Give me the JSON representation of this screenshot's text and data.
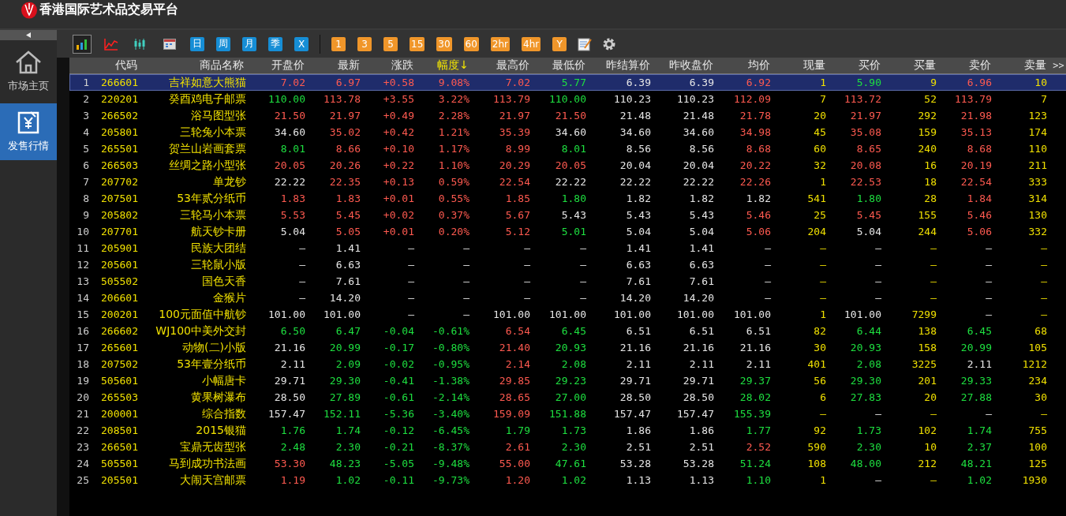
{
  "window": {
    "title": "香港国际艺术品交易平台"
  },
  "sidebar": {
    "items": [
      {
        "label": "市场主页",
        "selected": false
      },
      {
        "label": "发售行情",
        "selected": true
      }
    ]
  },
  "toolbar": {
    "chart_types": [
      {
        "selected": true
      },
      {
        "selected": false
      },
      {
        "selected": false
      },
      {
        "selected": false
      }
    ],
    "periods": [
      {
        "label": "日",
        "kind": "span"
      },
      {
        "label": "周",
        "kind": "span"
      },
      {
        "label": "月",
        "kind": "span"
      },
      {
        "label": "季",
        "kind": "span"
      },
      {
        "label": "X",
        "kind": "span"
      },
      {
        "label": "1",
        "kind": "interval"
      },
      {
        "label": "3",
        "kind": "interval"
      },
      {
        "label": "5",
        "kind": "interval"
      },
      {
        "label": "15",
        "kind": "interval"
      },
      {
        "label": "30",
        "kind": "interval"
      },
      {
        "label": "60",
        "kind": "interval"
      },
      {
        "label": "2hr",
        "kind": "interval"
      },
      {
        "label": "4hr",
        "kind": "interval"
      },
      {
        "label": "Y",
        "kind": "interval"
      }
    ]
  },
  "table": {
    "code_header": "代码",
    "name_header": "商品名称",
    "columns": [
      {
        "label": "开盘价",
        "sorted": false
      },
      {
        "label": "最新",
        "sorted": false
      },
      {
        "label": "涨跌",
        "sorted": false
      },
      {
        "label": "幅度↓",
        "sorted": true
      },
      {
        "label": "最高价",
        "sorted": false
      },
      {
        "label": "最低价",
        "sorted": false
      },
      {
        "label": "昨结算价",
        "sorted": false
      },
      {
        "label": "昨收盘价",
        "sorted": false
      },
      {
        "label": "均价",
        "sorted": false
      },
      {
        "label": "现量",
        "sorted": false,
        "kind": "quantity"
      },
      {
        "label": "买价",
        "sorted": false
      },
      {
        "label": "买量",
        "sorted": false,
        "kind": "quantity"
      },
      {
        "label": "卖价",
        "sorted": false
      },
      {
        "label": "卖量",
        "sorted": false,
        "kind": "quantity"
      }
    ],
    "more_columns": ">>",
    "rows": [
      {
        "index": "1",
        "code": "266601",
        "name": "吉祥如意大熊猫",
        "selected": true,
        "cells": [
          {
            "text": "7.02",
            "color": "#ff5a50"
          },
          {
            "text": "6.97",
            "color": "#ff5a50"
          },
          {
            "text": "+0.58",
            "color": "#ff5a50"
          },
          {
            "text": "9.08%",
            "color": "#ff5a50"
          },
          {
            "text": "7.02",
            "color": "#ff5a50"
          },
          {
            "text": "5.77",
            "color": "#1ee040"
          },
          {
            "text": "6.39",
            "color": "#e6e6e6"
          },
          {
            "text": "6.39",
            "color": "#e6e6e6"
          },
          {
            "text": "6.92",
            "color": "#ff5a50"
          },
          {
            "text": "1",
            "color": "#f0e000"
          },
          {
            "text": "5.90",
            "color": "#1ee040"
          },
          {
            "text": "9",
            "color": "#f0e000"
          },
          {
            "text": "6.96",
            "color": "#ff5a50"
          },
          {
            "text": "10",
            "color": "#f0e000"
          }
        ]
      },
      {
        "index": "2",
        "code": "220201",
        "name": "癸酉鸡电子邮票",
        "selected": false,
        "cells": [
          {
            "text": "110.00",
            "color": "#1ee040"
          },
          {
            "text": "113.78",
            "color": "#ff5a50"
          },
          {
            "text": "+3.55",
            "color": "#ff5a50"
          },
          {
            "text": "3.22%",
            "color": "#ff5a50"
          },
          {
            "text": "113.79",
            "color": "#ff5a50"
          },
          {
            "text": "110.00",
            "color": "#1ee040"
          },
          {
            "text": "110.23",
            "color": "#e6e6e6"
          },
          {
            "text": "110.23",
            "color": "#e6e6e6"
          },
          {
            "text": "112.09",
            "color": "#ff5a50"
          },
          {
            "text": "7",
            "color": "#f0e000"
          },
          {
            "text": "113.72",
            "color": "#ff5a50"
          },
          {
            "text": "52",
            "color": "#f0e000"
          },
          {
            "text": "113.79",
            "color": "#ff5a50"
          },
          {
            "text": "7",
            "color": "#f0e000"
          }
        ]
      },
      {
        "index": "3",
        "code": "266502",
        "name": "浴马图型张",
        "selected": false,
        "cells": [
          {
            "text": "21.50",
            "color": "#ff5a50"
          },
          {
            "text": "21.97",
            "color": "#ff5a50"
          },
          {
            "text": "+0.49",
            "color": "#ff5a50"
          },
          {
            "text": "2.28%",
            "color": "#ff5a50"
          },
          {
            "text": "21.97",
            "color": "#ff5a50"
          },
          {
            "text": "21.50",
            "color": "#ff5a50"
          },
          {
            "text": "21.48",
            "color": "#e6e6e6"
          },
          {
            "text": "21.48",
            "color": "#e6e6e6"
          },
          {
            "text": "21.78",
            "color": "#ff5a50"
          },
          {
            "text": "20",
            "color": "#f0e000"
          },
          {
            "text": "21.97",
            "color": "#ff5a50"
          },
          {
            "text": "292",
            "color": "#f0e000"
          },
          {
            "text": "21.98",
            "color": "#ff5a50"
          },
          {
            "text": "123",
            "color": "#f0e000"
          }
        ]
      },
      {
        "index": "4",
        "code": "205801",
        "name": "三轮兔小本票",
        "selected": false,
        "cells": [
          {
            "text": "34.60",
            "color": "#e6e6e6"
          },
          {
            "text": "35.02",
            "color": "#ff5a50"
          },
          {
            "text": "+0.42",
            "color": "#ff5a50"
          },
          {
            "text": "1.21%",
            "color": "#ff5a50"
          },
          {
            "text": "35.39",
            "color": "#ff5a50"
          },
          {
            "text": "34.60",
            "color": "#e6e6e6"
          },
          {
            "text": "34.60",
            "color": "#e6e6e6"
          },
          {
            "text": "34.60",
            "color": "#e6e6e6"
          },
          {
            "text": "34.98",
            "color": "#ff5a50"
          },
          {
            "text": "45",
            "color": "#f0e000"
          },
          {
            "text": "35.08",
            "color": "#ff5a50"
          },
          {
            "text": "159",
            "color": "#f0e000"
          },
          {
            "text": "35.13",
            "color": "#ff5a50"
          },
          {
            "text": "174",
            "color": "#f0e000"
          }
        ]
      },
      {
        "index": "5",
        "code": "265501",
        "name": "贺兰山岩画套票",
        "selected": false,
        "cells": [
          {
            "text": "8.01",
            "color": "#1ee040"
          },
          {
            "text": "8.66",
            "color": "#ff5a50"
          },
          {
            "text": "+0.10",
            "color": "#ff5a50"
          },
          {
            "text": "1.17%",
            "color": "#ff5a50"
          },
          {
            "text": "8.99",
            "color": "#ff5a50"
          },
          {
            "text": "8.01",
            "color": "#1ee040"
          },
          {
            "text": "8.56",
            "color": "#e6e6e6"
          },
          {
            "text": "8.56",
            "color": "#e6e6e6"
          },
          {
            "text": "8.68",
            "color": "#ff5a50"
          },
          {
            "text": "60",
            "color": "#f0e000"
          },
          {
            "text": "8.65",
            "color": "#ff5a50"
          },
          {
            "text": "240",
            "color": "#f0e000"
          },
          {
            "text": "8.68",
            "color": "#ff5a50"
          },
          {
            "text": "110",
            "color": "#f0e000"
          }
        ]
      },
      {
        "index": "6",
        "code": "266503",
        "name": "丝绸之路小型张",
        "selected": false,
        "cells": [
          {
            "text": "20.05",
            "color": "#ff5a50"
          },
          {
            "text": "20.26",
            "color": "#ff5a50"
          },
          {
            "text": "+0.22",
            "color": "#ff5a50"
          },
          {
            "text": "1.10%",
            "color": "#ff5a50"
          },
          {
            "text": "20.29",
            "color": "#ff5a50"
          },
          {
            "text": "20.05",
            "color": "#ff5a50"
          },
          {
            "text": "20.04",
            "color": "#e6e6e6"
          },
          {
            "text": "20.04",
            "color": "#e6e6e6"
          },
          {
            "text": "20.22",
            "color": "#ff5a50"
          },
          {
            "text": "32",
            "color": "#f0e000"
          },
          {
            "text": "20.08",
            "color": "#ff5a50"
          },
          {
            "text": "16",
            "color": "#f0e000"
          },
          {
            "text": "20.19",
            "color": "#ff5a50"
          },
          {
            "text": "211",
            "color": "#f0e000"
          }
        ]
      },
      {
        "index": "7",
        "code": "207702",
        "name": "单龙钞",
        "selected": false,
        "cells": [
          {
            "text": "22.22",
            "color": "#e6e6e6"
          },
          {
            "text": "22.35",
            "color": "#ff5a50"
          },
          {
            "text": "+0.13",
            "color": "#ff5a50"
          },
          {
            "text": "0.59%",
            "color": "#ff5a50"
          },
          {
            "text": "22.54",
            "color": "#ff5a50"
          },
          {
            "text": "22.22",
            "color": "#e6e6e6"
          },
          {
            "text": "22.22",
            "color": "#e6e6e6"
          },
          {
            "text": "22.22",
            "color": "#e6e6e6"
          },
          {
            "text": "22.26",
            "color": "#ff5a50"
          },
          {
            "text": "1",
            "color": "#f0e000"
          },
          {
            "text": "22.53",
            "color": "#ff5a50"
          },
          {
            "text": "18",
            "color": "#f0e000"
          },
          {
            "text": "22.54",
            "color": "#ff5a50"
          },
          {
            "text": "333",
            "color": "#f0e000"
          }
        ]
      },
      {
        "index": "8",
        "code": "207501",
        "name": "53年贰分纸币",
        "selected": false,
        "cells": [
          {
            "text": "1.83",
            "color": "#ff5a50"
          },
          {
            "text": "1.83",
            "color": "#ff5a50"
          },
          {
            "text": "+0.01",
            "color": "#ff5a50"
          },
          {
            "text": "0.55%",
            "color": "#ff5a50"
          },
          {
            "text": "1.85",
            "color": "#ff5a50"
          },
          {
            "text": "1.80",
            "color": "#1ee040"
          },
          {
            "text": "1.82",
            "color": "#e6e6e6"
          },
          {
            "text": "1.82",
            "color": "#e6e6e6"
          },
          {
            "text": "1.82",
            "color": "#e6e6e6"
          },
          {
            "text": "541",
            "color": "#f0e000"
          },
          {
            "text": "1.80",
            "color": "#1ee040"
          },
          {
            "text": "28",
            "color": "#f0e000"
          },
          {
            "text": "1.84",
            "color": "#ff5a50"
          },
          {
            "text": "314",
            "color": "#f0e000"
          }
        ]
      },
      {
        "index": "9",
        "code": "205802",
        "name": "三轮马小本票",
        "selected": false,
        "cells": [
          {
            "text": "5.53",
            "color": "#ff5a50"
          },
          {
            "text": "5.45",
            "color": "#ff5a50"
          },
          {
            "text": "+0.02",
            "color": "#ff5a50"
          },
          {
            "text": "0.37%",
            "color": "#ff5a50"
          },
          {
            "text": "5.67",
            "color": "#ff5a50"
          },
          {
            "text": "5.43",
            "color": "#e6e6e6"
          },
          {
            "text": "5.43",
            "color": "#e6e6e6"
          },
          {
            "text": "5.43",
            "color": "#e6e6e6"
          },
          {
            "text": "5.46",
            "color": "#ff5a50"
          },
          {
            "text": "25",
            "color": "#f0e000"
          },
          {
            "text": "5.45",
            "color": "#ff5a50"
          },
          {
            "text": "155",
            "color": "#f0e000"
          },
          {
            "text": "5.46",
            "color": "#ff5a50"
          },
          {
            "text": "130",
            "color": "#f0e000"
          }
        ]
      },
      {
        "index": "10",
        "code": "207701",
        "name": "航天钞卡册",
        "selected": false,
        "cells": [
          {
            "text": "5.04",
            "color": "#e6e6e6"
          },
          {
            "text": "5.05",
            "color": "#ff5a50"
          },
          {
            "text": "+0.01",
            "color": "#ff5a50"
          },
          {
            "text": "0.20%",
            "color": "#ff5a50"
          },
          {
            "text": "5.12",
            "color": "#ff5a50"
          },
          {
            "text": "5.01",
            "color": "#1ee040"
          },
          {
            "text": "5.04",
            "color": "#e6e6e6"
          },
          {
            "text": "5.04",
            "color": "#e6e6e6"
          },
          {
            "text": "5.06",
            "color": "#ff5a50"
          },
          {
            "text": "204",
            "color": "#f0e000"
          },
          {
            "text": "5.04",
            "color": "#e6e6e6"
          },
          {
            "text": "244",
            "color": "#f0e000"
          },
          {
            "text": "5.06",
            "color": "#ff5a50"
          },
          {
            "text": "332",
            "color": "#f0e000"
          }
        ]
      },
      {
        "index": "11",
        "code": "205901",
        "name": "民族大团结",
        "selected": false,
        "cells": [
          {
            "text": "—"
          },
          {
            "text": "1.41",
            "color": "#e6e6e6"
          },
          {
            "text": "—"
          },
          {
            "text": "—"
          },
          {
            "text": "—"
          },
          {
            "text": "—"
          },
          {
            "text": "1.41",
            "color": "#e6e6e6"
          },
          {
            "text": "1.41",
            "color": "#e6e6e6"
          },
          {
            "text": "—"
          },
          {
            "text": "—"
          },
          {
            "text": "—"
          },
          {
            "text": "—"
          },
          {
            "text": "—"
          },
          {
            "text": "—"
          }
        ]
      },
      {
        "index": "12",
        "code": "205601",
        "name": "三轮鼠小版",
        "selected": false,
        "cells": [
          {
            "text": "—"
          },
          {
            "text": "6.63",
            "color": "#e6e6e6"
          },
          {
            "text": "—"
          },
          {
            "text": "—"
          },
          {
            "text": "—"
          },
          {
            "text": "—"
          },
          {
            "text": "6.63",
            "color": "#e6e6e6"
          },
          {
            "text": "6.63",
            "color": "#e6e6e6"
          },
          {
            "text": "—"
          },
          {
            "text": "—"
          },
          {
            "text": "—"
          },
          {
            "text": "—"
          },
          {
            "text": "—"
          },
          {
            "text": "—"
          }
        ]
      },
      {
        "index": "13",
        "code": "505502",
        "name": "国色天香",
        "selected": false,
        "cells": [
          {
            "text": "—"
          },
          {
            "text": "7.61",
            "color": "#e6e6e6"
          },
          {
            "text": "—"
          },
          {
            "text": "—"
          },
          {
            "text": "—"
          },
          {
            "text": "—"
          },
          {
            "text": "7.61",
            "color": "#e6e6e6"
          },
          {
            "text": "7.61",
            "color": "#e6e6e6"
          },
          {
            "text": "—"
          },
          {
            "text": "—"
          },
          {
            "text": "—"
          },
          {
            "text": "—"
          },
          {
            "text": "—"
          },
          {
            "text": "—"
          }
        ]
      },
      {
        "index": "14",
        "code": "206601",
        "name": "金猴片",
        "selected": false,
        "cells": [
          {
            "text": "—"
          },
          {
            "text": "14.20",
            "color": "#e6e6e6"
          },
          {
            "text": "—"
          },
          {
            "text": "—"
          },
          {
            "text": "—"
          },
          {
            "text": "—"
          },
          {
            "text": "14.20",
            "color": "#e6e6e6"
          },
          {
            "text": "14.20",
            "color": "#e6e6e6"
          },
          {
            "text": "—"
          },
          {
            "text": "—"
          },
          {
            "text": "—"
          },
          {
            "text": "—"
          },
          {
            "text": "—"
          },
          {
            "text": "—"
          }
        ]
      },
      {
        "index": "15",
        "code": "200201",
        "name": "100元面值中航钞",
        "selected": false,
        "cells": [
          {
            "text": "101.00",
            "color": "#e6e6e6"
          },
          {
            "text": "101.00",
            "color": "#e6e6e6"
          },
          {
            "text": "—"
          },
          {
            "text": "—"
          },
          {
            "text": "101.00",
            "color": "#e6e6e6"
          },
          {
            "text": "101.00",
            "color": "#e6e6e6"
          },
          {
            "text": "101.00",
            "color": "#e6e6e6"
          },
          {
            "text": "101.00",
            "color": "#e6e6e6"
          },
          {
            "text": "101.00",
            "color": "#e6e6e6"
          },
          {
            "text": "1",
            "color": "#f0e000"
          },
          {
            "text": "101.00",
            "color": "#e6e6e6"
          },
          {
            "text": "7299",
            "color": "#f0e000"
          },
          {
            "text": "—"
          },
          {
            "text": "—"
          }
        ]
      },
      {
        "index": "16",
        "code": "266602",
        "name": "WJ100中美外交封",
        "selected": false,
        "cells": [
          {
            "text": "6.50",
            "color": "#1ee040"
          },
          {
            "text": "6.47",
            "color": "#1ee040"
          },
          {
            "text": "-0.04",
            "color": "#1ee040"
          },
          {
            "text": "-0.61%",
            "color": "#1ee040"
          },
          {
            "text": "6.54",
            "color": "#ff5a50"
          },
          {
            "text": "6.45",
            "color": "#1ee040"
          },
          {
            "text": "6.51",
            "color": "#e6e6e6"
          },
          {
            "text": "6.51",
            "color": "#e6e6e6"
          },
          {
            "text": "6.51",
            "color": "#e6e6e6"
          },
          {
            "text": "82",
            "color": "#f0e000"
          },
          {
            "text": "6.44",
            "color": "#1ee040"
          },
          {
            "text": "138",
            "color": "#f0e000"
          },
          {
            "text": "6.45",
            "color": "#1ee040"
          },
          {
            "text": "68",
            "color": "#f0e000"
          }
        ]
      },
      {
        "index": "17",
        "code": "265601",
        "name": "动物(二)小版",
        "selected": false,
        "cells": [
          {
            "text": "21.16",
            "color": "#e6e6e6"
          },
          {
            "text": "20.99",
            "color": "#1ee040"
          },
          {
            "text": "-0.17",
            "color": "#1ee040"
          },
          {
            "text": "-0.80%",
            "color": "#1ee040"
          },
          {
            "text": "21.40",
            "color": "#ff5a50"
          },
          {
            "text": "20.93",
            "color": "#1ee040"
          },
          {
            "text": "21.16",
            "color": "#e6e6e6"
          },
          {
            "text": "21.16",
            "color": "#e6e6e6"
          },
          {
            "text": "21.16",
            "color": "#e6e6e6"
          },
          {
            "text": "30",
            "color": "#f0e000"
          },
          {
            "text": "20.93",
            "color": "#1ee040"
          },
          {
            "text": "158",
            "color": "#f0e000"
          },
          {
            "text": "20.99",
            "color": "#1ee040"
          },
          {
            "text": "105",
            "color": "#f0e000"
          }
        ]
      },
      {
        "index": "18",
        "code": "207502",
        "name": "53年壹分纸币",
        "selected": false,
        "cells": [
          {
            "text": "2.11",
            "color": "#e6e6e6"
          },
          {
            "text": "2.09",
            "color": "#1ee040"
          },
          {
            "text": "-0.02",
            "color": "#1ee040"
          },
          {
            "text": "-0.95%",
            "color": "#1ee040"
          },
          {
            "text": "2.14",
            "color": "#ff5a50"
          },
          {
            "text": "2.08",
            "color": "#1ee040"
          },
          {
            "text": "2.11",
            "color": "#e6e6e6"
          },
          {
            "text": "2.11",
            "color": "#e6e6e6"
          },
          {
            "text": "2.11",
            "color": "#e6e6e6"
          },
          {
            "text": "401",
            "color": "#f0e000"
          },
          {
            "text": "2.08",
            "color": "#1ee040"
          },
          {
            "text": "3225",
            "color": "#f0e000"
          },
          {
            "text": "2.11",
            "color": "#e6e6e6"
          },
          {
            "text": "1212",
            "color": "#f0e000"
          }
        ]
      },
      {
        "index": "19",
        "code": "505601",
        "name": "小幅唐卡",
        "selected": false,
        "cells": [
          {
            "text": "29.71",
            "color": "#e6e6e6"
          },
          {
            "text": "29.30",
            "color": "#1ee040"
          },
          {
            "text": "-0.41",
            "color": "#1ee040"
          },
          {
            "text": "-1.38%",
            "color": "#1ee040"
          },
          {
            "text": "29.85",
            "color": "#ff5a50"
          },
          {
            "text": "29.23",
            "color": "#1ee040"
          },
          {
            "text": "29.71",
            "color": "#e6e6e6"
          },
          {
            "text": "29.71",
            "color": "#e6e6e6"
          },
          {
            "text": "29.37",
            "color": "#1ee040"
          },
          {
            "text": "56",
            "color": "#f0e000"
          },
          {
            "text": "29.30",
            "color": "#1ee040"
          },
          {
            "text": "201",
            "color": "#f0e000"
          },
          {
            "text": "29.33",
            "color": "#1ee040"
          },
          {
            "text": "234",
            "color": "#f0e000"
          }
        ]
      },
      {
        "index": "20",
        "code": "265503",
        "name": "黄果树瀑布",
        "selected": false,
        "cells": [
          {
            "text": "28.50",
            "color": "#e6e6e6"
          },
          {
            "text": "27.89",
            "color": "#1ee040"
          },
          {
            "text": "-0.61",
            "color": "#1ee040"
          },
          {
            "text": "-2.14%",
            "color": "#1ee040"
          },
          {
            "text": "28.65",
            "color": "#ff5a50"
          },
          {
            "text": "27.00",
            "color": "#1ee040"
          },
          {
            "text": "28.50",
            "color": "#e6e6e6"
          },
          {
            "text": "28.50",
            "color": "#e6e6e6"
          },
          {
            "text": "28.02",
            "color": "#1ee040"
          },
          {
            "text": "6",
            "color": "#f0e000"
          },
          {
            "text": "27.83",
            "color": "#1ee040"
          },
          {
            "text": "20",
            "color": "#f0e000"
          },
          {
            "text": "27.88",
            "color": "#1ee040"
          },
          {
            "text": "30",
            "color": "#f0e000"
          }
        ]
      },
      {
        "index": "21",
        "code": "200001",
        "name": "综合指数",
        "selected": false,
        "cells": [
          {
            "text": "157.47",
            "color": "#e6e6e6"
          },
          {
            "text": "152.11",
            "color": "#1ee040"
          },
          {
            "text": "-5.36",
            "color": "#1ee040"
          },
          {
            "text": "-3.40%",
            "color": "#1ee040"
          },
          {
            "text": "159.09",
            "color": "#ff5a50"
          },
          {
            "text": "151.88",
            "color": "#1ee040"
          },
          {
            "text": "157.47",
            "color": "#e6e6e6"
          },
          {
            "text": "157.47",
            "color": "#e6e6e6"
          },
          {
            "text": "155.39",
            "color": "#1ee040"
          },
          {
            "text": "—"
          },
          {
            "text": "—"
          },
          {
            "text": "—"
          },
          {
            "text": "—"
          },
          {
            "text": "—"
          }
        ]
      },
      {
        "index": "22",
        "code": "208501",
        "name": "2015银猫",
        "selected": false,
        "cells": [
          {
            "text": "1.76",
            "color": "#1ee040"
          },
          {
            "text": "1.74",
            "color": "#1ee040"
          },
          {
            "text": "-0.12",
            "color": "#1ee040"
          },
          {
            "text": "-6.45%",
            "color": "#1ee040"
          },
          {
            "text": "1.79",
            "color": "#1ee040"
          },
          {
            "text": "1.73",
            "color": "#1ee040"
          },
          {
            "text": "1.86",
            "color": "#e6e6e6"
          },
          {
            "text": "1.86",
            "color": "#e6e6e6"
          },
          {
            "text": "1.77",
            "color": "#1ee040"
          },
          {
            "text": "92",
            "color": "#f0e000"
          },
          {
            "text": "1.73",
            "color": "#1ee040"
          },
          {
            "text": "102",
            "color": "#f0e000"
          },
          {
            "text": "1.74",
            "color": "#1ee040"
          },
          {
            "text": "755",
            "color": "#f0e000"
          }
        ]
      },
      {
        "index": "23",
        "code": "266501",
        "name": "宝鼎无齿型张",
        "selected": false,
        "cells": [
          {
            "text": "2.48",
            "color": "#1ee040"
          },
          {
            "text": "2.30",
            "color": "#1ee040"
          },
          {
            "text": "-0.21",
            "color": "#1ee040"
          },
          {
            "text": "-8.37%",
            "color": "#1ee040"
          },
          {
            "text": "2.61",
            "color": "#ff5a50"
          },
          {
            "text": "2.30",
            "color": "#1ee040"
          },
          {
            "text": "2.51",
            "color": "#e6e6e6"
          },
          {
            "text": "2.51",
            "color": "#e6e6e6"
          },
          {
            "text": "2.52",
            "color": "#ff5a50"
          },
          {
            "text": "590",
            "color": "#f0e000"
          },
          {
            "text": "2.30",
            "color": "#1ee040"
          },
          {
            "text": "10",
            "color": "#f0e000"
          },
          {
            "text": "2.37",
            "color": "#1ee040"
          },
          {
            "text": "100",
            "color": "#f0e000"
          }
        ]
      },
      {
        "index": "24",
        "code": "505501",
        "name": "马到成功书法画",
        "selected": false,
        "cells": [
          {
            "text": "53.30",
            "color": "#ff5a50"
          },
          {
            "text": "48.23",
            "color": "#1ee040"
          },
          {
            "text": "-5.05",
            "color": "#1ee040"
          },
          {
            "text": "-9.48%",
            "color": "#1ee040"
          },
          {
            "text": "55.00",
            "color": "#ff5a50"
          },
          {
            "text": "47.61",
            "color": "#1ee040"
          },
          {
            "text": "53.28",
            "color": "#e6e6e6"
          },
          {
            "text": "53.28",
            "color": "#e6e6e6"
          },
          {
            "text": "51.24",
            "color": "#1ee040"
          },
          {
            "text": "108",
            "color": "#f0e000"
          },
          {
            "text": "48.00",
            "color": "#1ee040"
          },
          {
            "text": "212",
            "color": "#f0e000"
          },
          {
            "text": "48.21",
            "color": "#1ee040"
          },
          {
            "text": "125",
            "color": "#f0e000"
          }
        ]
      },
      {
        "index": "25",
        "code": "205501",
        "name": "大闹天宫邮票",
        "selected": false,
        "cells": [
          {
            "text": "1.19",
            "color": "#ff5a50"
          },
          {
            "text": "1.02",
            "color": "#1ee040"
          },
          {
            "text": "-0.11",
            "color": "#1ee040"
          },
          {
            "text": "-9.73%",
            "color": "#1ee040"
          },
          {
            "text": "1.20",
            "color": "#ff5a50"
          },
          {
            "text": "1.02",
            "color": "#1ee040"
          },
          {
            "text": "1.13",
            "color": "#e6e6e6"
          },
          {
            "text": "1.13",
            "color": "#e6e6e6"
          },
          {
            "text": "1.10",
            "color": "#1ee040"
          },
          {
            "text": "1",
            "color": "#f0e000"
          },
          {
            "text": "—"
          },
          {
            "text": "—"
          },
          {
            "text": "1.02",
            "color": "#1ee040"
          },
          {
            "text": "1930",
            "color": "#f0e000"
          }
        ]
      }
    ]
  }
}
